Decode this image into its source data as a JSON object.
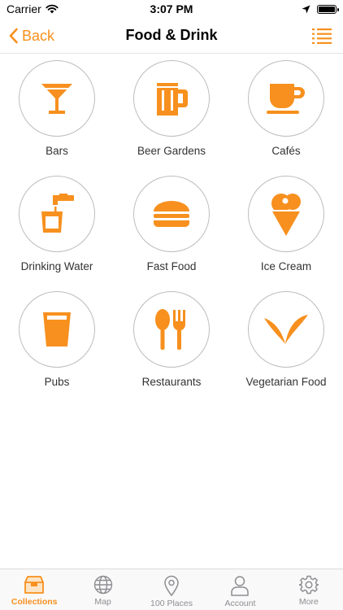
{
  "status_bar": {
    "carrier": "Carrier",
    "time": "3:07 PM"
  },
  "nav": {
    "back_label": "Back",
    "title": "Food & Drink"
  },
  "accent_color": "#f7901e",
  "categories": [
    {
      "label": "Bars",
      "icon": "cocktail-glass-icon"
    },
    {
      "label": "Beer Gardens",
      "icon": "beer-mug-icon"
    },
    {
      "label": "Cafés",
      "icon": "coffee-cup-icon"
    },
    {
      "label": "Drinking Water",
      "icon": "water-tap-icon"
    },
    {
      "label": "Fast Food",
      "icon": "burger-icon"
    },
    {
      "label": "Ice Cream",
      "icon": "ice-cream-cone-icon"
    },
    {
      "label": "Pubs",
      "icon": "pint-glass-icon"
    },
    {
      "label": "Restaurants",
      "icon": "cutlery-icon"
    },
    {
      "label": "Vegetarian Food",
      "icon": "leaf-icon"
    }
  ],
  "tabs": [
    {
      "label": "Collections",
      "icon": "box-icon",
      "active": true
    },
    {
      "label": "Map",
      "icon": "globe-icon",
      "active": false
    },
    {
      "label": "100 Places",
      "icon": "location-pin-icon",
      "active": false
    },
    {
      "label": "Account",
      "icon": "person-icon",
      "active": false
    },
    {
      "label": "More",
      "icon": "gear-icon",
      "active": false
    }
  ]
}
